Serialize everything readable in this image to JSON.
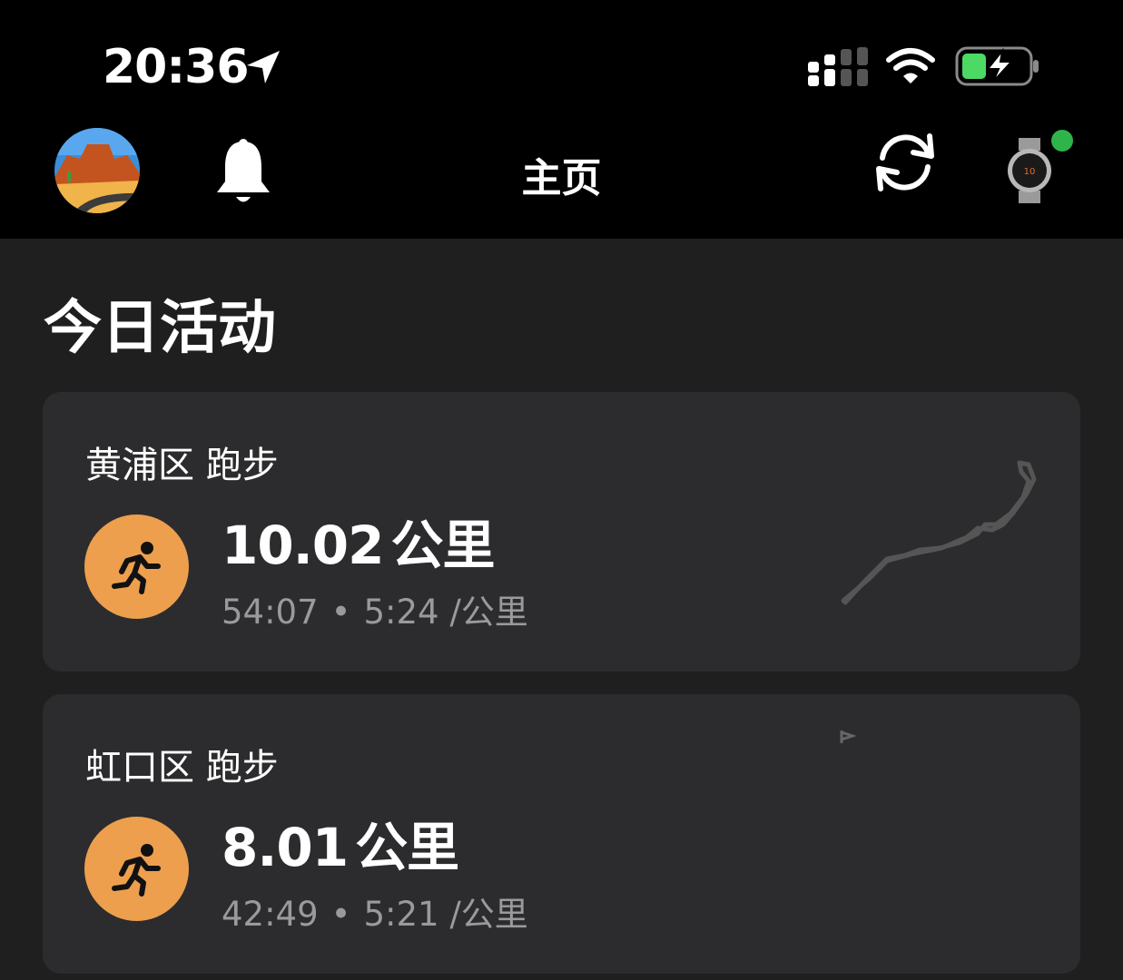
{
  "status_bar": {
    "time": "20:36",
    "icons": [
      "location-arrow-icon",
      "cellular-signal-icon",
      "wifi-icon",
      "battery-charging-icon"
    ]
  },
  "nav": {
    "title": "主页",
    "icons": [
      "avatar",
      "bell-icon",
      "sync-icon",
      "watch-icon"
    ],
    "watch_status_color": "#2fb44a"
  },
  "section": {
    "title": "今日活动"
  },
  "activities": [
    {
      "title": "黄浦区 跑步",
      "distance": "10.02",
      "distance_unit": "公里",
      "duration": "54:07",
      "pace": "5:24 /公里",
      "icon": "running-icon"
    },
    {
      "title": "虹口区 跑步",
      "distance": "8.01",
      "distance_unit": "公里",
      "duration": "42:49",
      "pace": "5:21 /公里",
      "icon": "running-icon"
    }
  ],
  "colors": {
    "accent": "#ed9f4d",
    "background": "#1f1f1f",
    "card": "#2c2c2e",
    "secondary_text": "#9a9a9a"
  }
}
